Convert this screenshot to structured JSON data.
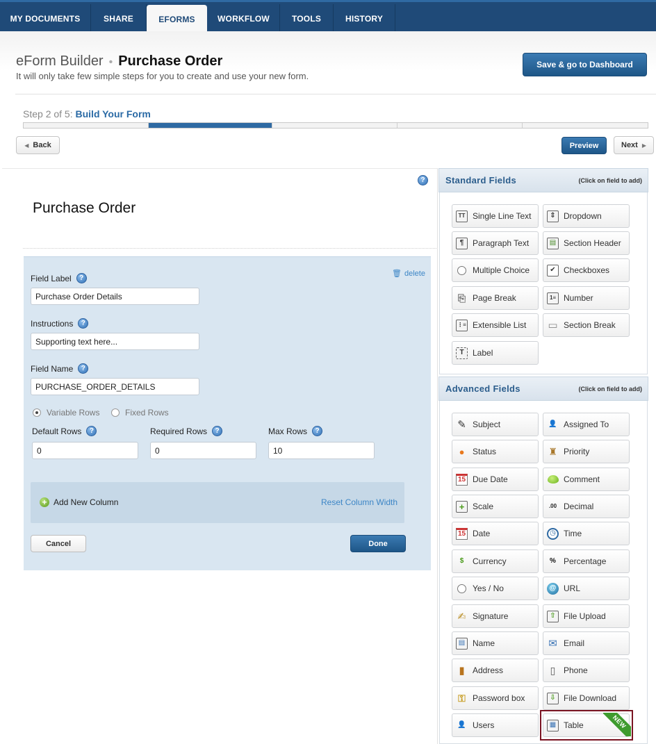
{
  "nav": {
    "tabs": [
      {
        "label": "MY DOCUMENTS"
      },
      {
        "label": "SHARE"
      },
      {
        "label": "EFORMS",
        "active": true
      },
      {
        "label": "WORKFLOW"
      },
      {
        "label": "TOOLS"
      },
      {
        "label": "HISTORY"
      }
    ]
  },
  "header": {
    "app": "eForm Builder",
    "separator": "•",
    "form_name": "Purchase Order",
    "subtitle": "It will only take few simple steps for you to create and use your new form.",
    "save_button": "Save & go to Dashboard"
  },
  "steps": {
    "prefix": "Step 2 of 5:",
    "current": "Build Your Form",
    "current_step": 2,
    "total_steps": 5,
    "back": "Back",
    "preview": "Preview",
    "next": "Next"
  },
  "builder": {
    "form_title": "Purchase Order",
    "help": "?",
    "delete": "delete",
    "field_label": {
      "label": "Field Label",
      "value": "Purchase Order Details"
    },
    "instructions": {
      "label": "Instructions",
      "value": "Supporting text here..."
    },
    "field_name": {
      "label": "Field Name",
      "value": "PURCHASE_ORDER_DETAILS"
    },
    "row_mode": {
      "variable": "Variable Rows",
      "fixed": "Fixed Rows",
      "selected": "Variable Rows"
    },
    "default_rows": {
      "label": "Default Rows",
      "value": "0"
    },
    "required_rows": {
      "label": "Required Rows",
      "value": "0"
    },
    "max_rows": {
      "label": "Max Rows",
      "value": "10"
    },
    "add_column": "Add New Column",
    "reset_width": "Reset Column Width",
    "cancel": "Cancel",
    "done": "Done"
  },
  "standard": {
    "title": "Standard Fields",
    "hint": "(Click on field to add)",
    "fields": [
      {
        "label": "Single Line Text",
        "icon": "single-line-text-icon",
        "glyph": "TT"
      },
      {
        "label": "Dropdown",
        "icon": "dropdown-icon",
        "glyph": "⇕"
      },
      {
        "label": "Paragraph Text",
        "icon": "paragraph-text-icon",
        "glyph": "¶"
      },
      {
        "label": "Section Header",
        "icon": "section-header-icon",
        "glyph": "▤"
      },
      {
        "label": "Multiple Choice",
        "icon": "radio-icon",
        "glyph": ""
      },
      {
        "label": "Checkboxes",
        "icon": "checkbox-icon",
        "glyph": "✔"
      },
      {
        "label": "Page Break",
        "icon": "page-break-icon",
        "glyph": "⎘"
      },
      {
        "label": "Number",
        "icon": "number-icon",
        "glyph": "1≡"
      },
      {
        "label": "Extensible List",
        "icon": "extensible-list-icon",
        "glyph": "⋮≡"
      },
      {
        "label": "Section Break",
        "icon": "section-break-icon",
        "glyph": "▭"
      },
      {
        "label": "Label",
        "icon": "label-icon",
        "glyph": "T"
      }
    ]
  },
  "advanced": {
    "title": "Advanced Fields",
    "hint": "(Click on field to add)",
    "fields": [
      {
        "label": "Subject",
        "icon": "pencil-icon",
        "glyph": "✎"
      },
      {
        "label": "Assigned To",
        "icon": "user-icon",
        "glyph": "👤"
      },
      {
        "label": "Status",
        "icon": "status-icon",
        "glyph": "●"
      },
      {
        "label": "Priority",
        "icon": "priority-icon",
        "glyph": "♜"
      },
      {
        "label": "Due Date",
        "icon": "calendar-icon",
        "glyph": "15"
      },
      {
        "label": "Comment",
        "icon": "comment-icon",
        "glyph": ""
      },
      {
        "label": "Scale",
        "icon": "scale-icon",
        "glyph": "+"
      },
      {
        "label": "Decimal",
        "icon": "decimal-icon",
        "glyph": ".00"
      },
      {
        "label": "Date",
        "icon": "date-icon",
        "glyph": "15"
      },
      {
        "label": "Time",
        "icon": "clock-icon",
        "glyph": "◷"
      },
      {
        "label": "Currency",
        "icon": "dollar-icon",
        "glyph": "$"
      },
      {
        "label": "Percentage",
        "icon": "percent-icon",
        "glyph": "%"
      },
      {
        "label": "Yes / No",
        "icon": "yes-no-icon",
        "glyph": ""
      },
      {
        "label": "URL",
        "icon": "globe-icon",
        "glyph": "@"
      },
      {
        "label": "Signature",
        "icon": "signature-icon",
        "glyph": "✍"
      },
      {
        "label": "File Upload",
        "icon": "file-upload-icon",
        "glyph": "⇧"
      },
      {
        "label": "Name",
        "icon": "id-card-icon",
        "glyph": "▤"
      },
      {
        "label": "Email",
        "icon": "email-icon",
        "glyph": "✉"
      },
      {
        "label": "Address",
        "icon": "address-book-icon",
        "glyph": "▮"
      },
      {
        "label": "Phone",
        "icon": "phone-icon",
        "glyph": "▯"
      },
      {
        "label": "Password box",
        "icon": "key-icon",
        "glyph": "⚿"
      },
      {
        "label": "File Download",
        "icon": "file-download-icon",
        "glyph": "⇩"
      },
      {
        "label": "Users",
        "icon": "users-icon",
        "glyph": "👤"
      },
      {
        "label": "Table",
        "icon": "table-icon",
        "glyph": "▦"
      }
    ],
    "new_badge": "NEW"
  },
  "colors": {
    "nav": "#1f4a78",
    "primary_button": "#2f6aa3",
    "panel": "#d9e6f1",
    "highlight_border": "#7a1422",
    "new_ribbon": "#3e9b2e"
  }
}
